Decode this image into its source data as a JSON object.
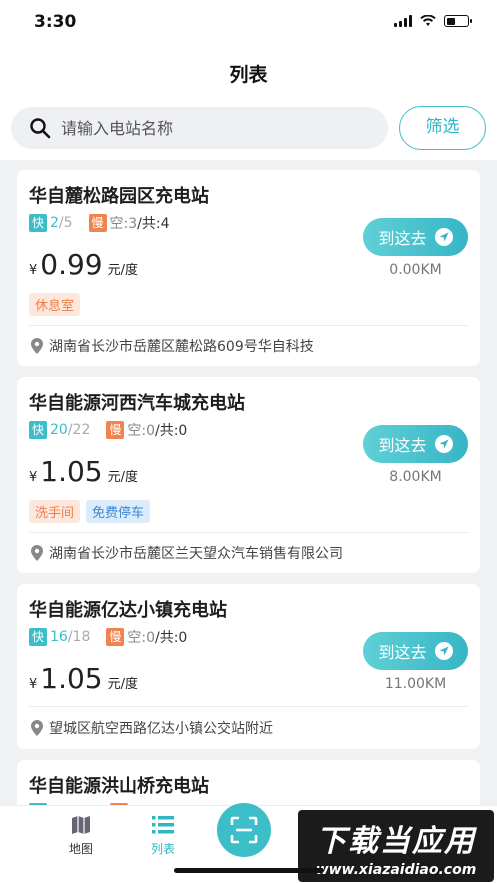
{
  "status": {
    "time": "3:30"
  },
  "nav": {
    "title": "列表"
  },
  "search": {
    "placeholder": "请输入电站名称",
    "filter_label": "筛选"
  },
  "stations": [
    {
      "name": "华自麓松路园区充电站",
      "fast_tag": "快",
      "fast_available": "2",
      "fast_total": "/5",
      "slow_tag": "慢",
      "slow_free": "空:3",
      "slow_total": "/共:4",
      "currency": "¥",
      "price": "0.99",
      "unit": "元/度",
      "amenities": [
        "休息室"
      ],
      "go_label": "到这去",
      "distance": "0.00KM",
      "address": "湖南省长沙市岳麓区麓松路609号华自科技"
    },
    {
      "name": "华自能源河西汽车城充电站",
      "fast_tag": "快",
      "fast_available": "20",
      "fast_total": "/22",
      "slow_tag": "慢",
      "slow_free": "空:0",
      "slow_total": "/共:0",
      "currency": "¥",
      "price": "1.05",
      "unit": "元/度",
      "amenities": [
        "洗手间",
        "免费停车"
      ],
      "go_label": "到这去",
      "distance": "8.00KM",
      "address": "湖南省长沙市岳麓区兰天望众汽车销售有限公司"
    },
    {
      "name": "华自能源亿达小镇充电站",
      "fast_tag": "快",
      "fast_available": "16",
      "fast_total": "/18",
      "slow_tag": "慢",
      "slow_free": "空:0",
      "slow_total": "/共:0",
      "currency": "¥",
      "price": "1.05",
      "unit": "元/度",
      "amenities": [],
      "go_label": "到这去",
      "distance": "11.00KM",
      "address": "望城区航空西路亿达小镇公交站附近"
    },
    {
      "name": "华自能源洪山桥充电站"
    }
  ],
  "tabbar": {
    "map_label": "地图",
    "list_label": "列表"
  },
  "watermark": {
    "main": "下载当应用",
    "url": "www.xiazaidiao.com"
  },
  "colors": {
    "accent": "#3cbec9",
    "fast": "#3cbec9",
    "slow": "#f0844f"
  }
}
